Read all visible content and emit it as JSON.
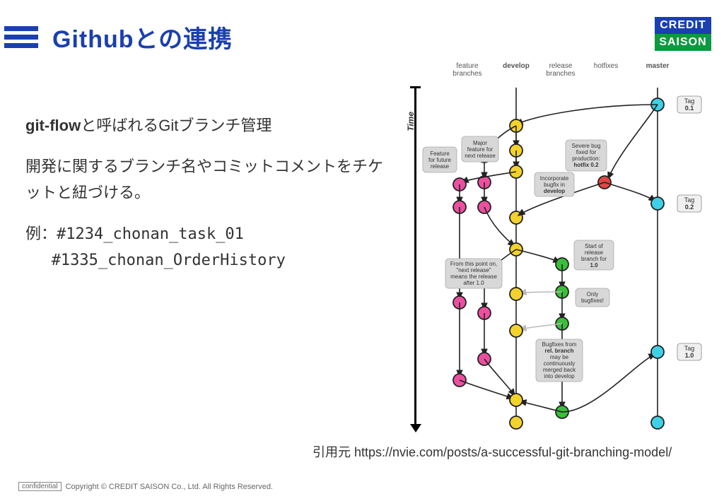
{
  "header": {
    "title": "Githubとの連携"
  },
  "logo": {
    "line1": "CREDIT",
    "line2": "SAISON"
  },
  "body": {
    "p1_bold": "git-flow",
    "p1_rest": "と呼ばれるGitブランチ管理",
    "p2": "開発に関するブランチ名やコミットコメントをチケットと紐づける。",
    "ex_label": "例：",
    "ex1": "#1234_chonan_task_01",
    "ex2": "#1335_chonan_OrderHistory"
  },
  "diagram": {
    "time": "Time",
    "cols": {
      "feature": "feature branches",
      "develop": "develop",
      "release": "release branches",
      "hotfix": "hotfixes",
      "master": "master"
    },
    "callouts": {
      "c1": [
        "Feature",
        "for future",
        "release"
      ],
      "c2": [
        "Major",
        "feature for",
        "next release"
      ],
      "c3": [
        "Severe bug",
        "fixed for",
        "production:",
        "hotfix 0.2"
      ],
      "c4": [
        "Incorporate",
        "bugfix in",
        "develop"
      ],
      "c5": [
        "From this point on,",
        "\"next release\"",
        "means the release",
        "after 1.0"
      ],
      "c6": [
        "Start of",
        "release",
        "branch for",
        "1.0"
      ],
      "c7": [
        "Only",
        "bugfixes!"
      ],
      "c8": [
        "Bugfixes from",
        "rel. branch",
        "may be",
        "continuously",
        "merged back",
        "into develop"
      ]
    },
    "tags": {
      "t1": "0.1",
      "t2": "0.2",
      "t3": "1.0",
      "tag": "Tag"
    }
  },
  "citation": "引用元 https://nvie.com/posts/a-successful-git-branching-model/",
  "footer": {
    "conf": "confidential",
    "copy": "Copyright © CREDIT SAISON Co., Ltd. All Rights Reserved."
  }
}
